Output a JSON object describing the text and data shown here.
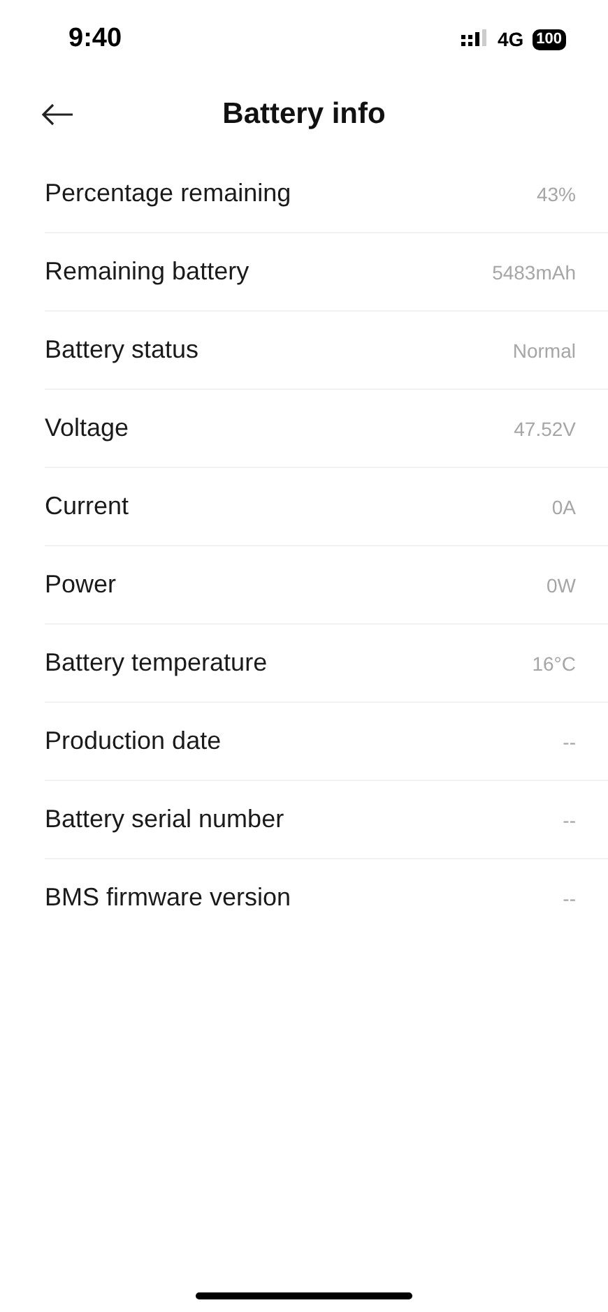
{
  "status_bar": {
    "time": "9:40",
    "network": "4G",
    "battery": "100"
  },
  "header": {
    "title": "Battery info"
  },
  "rows": [
    {
      "label": "Percentage remaining",
      "value": "43%"
    },
    {
      "label": "Remaining battery",
      "value": "5483mAh"
    },
    {
      "label": "Battery status",
      "value": "Normal"
    },
    {
      "label": "Voltage",
      "value": "47.52V"
    },
    {
      "label": "Current",
      "value": "0A"
    },
    {
      "label": "Power",
      "value": "0W"
    },
    {
      "label": "Battery temperature",
      "value": "16°C"
    },
    {
      "label": "Production date",
      "value": "--"
    },
    {
      "label": "Battery serial number",
      "value": "--"
    },
    {
      "label": "BMS firmware version",
      "value": "--"
    }
  ]
}
